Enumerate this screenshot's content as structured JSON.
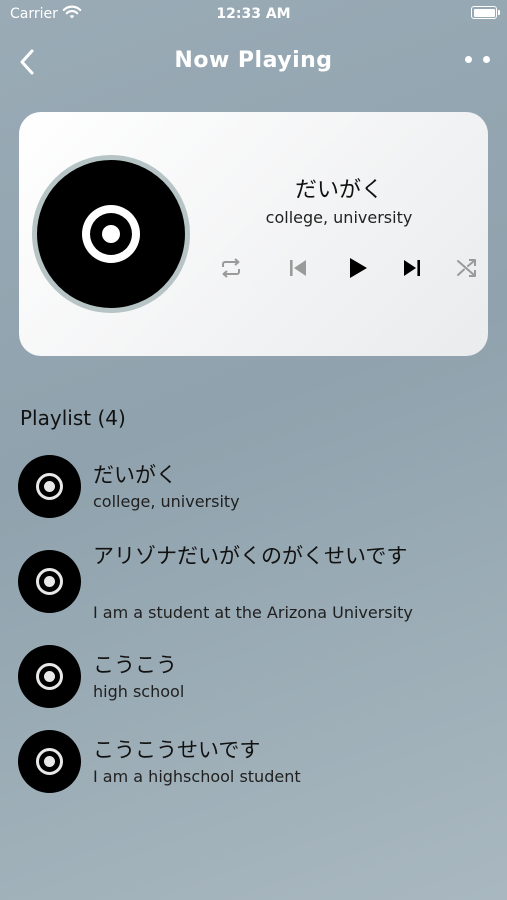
{
  "status_bar": {
    "carrier": "Carrier",
    "time": "12:33 AM"
  },
  "nav": {
    "title": "Now Playing"
  },
  "now_playing": {
    "title": "だいがく",
    "subtitle": "college, university"
  },
  "playlist": {
    "header": "Playlist (4)",
    "items": [
      {
        "title": "だいがく",
        "subtitle": "college, university"
      },
      {
        "title": "アリゾナだいがくのがくせいです",
        "subtitle": "I am a student at the Arizona University"
      },
      {
        "title": "こうこう",
        "subtitle": "high school"
      },
      {
        "title": "こうこうせいです",
        "subtitle": "I am a highschool student"
      }
    ]
  },
  "icons": {
    "back": "chevron-left-icon",
    "more": "more-dots-icon",
    "repeat": "repeat-icon",
    "previous": "skip-previous-icon",
    "play": "play-icon",
    "next": "skip-next-icon",
    "shuffle": "shuffle-icon"
  },
  "colors": {
    "background": "#9aabb6",
    "card": "#ffffff",
    "disc": "#000000",
    "disc_border": "#b7c4c6",
    "muted_control": "#9a9a9a"
  }
}
